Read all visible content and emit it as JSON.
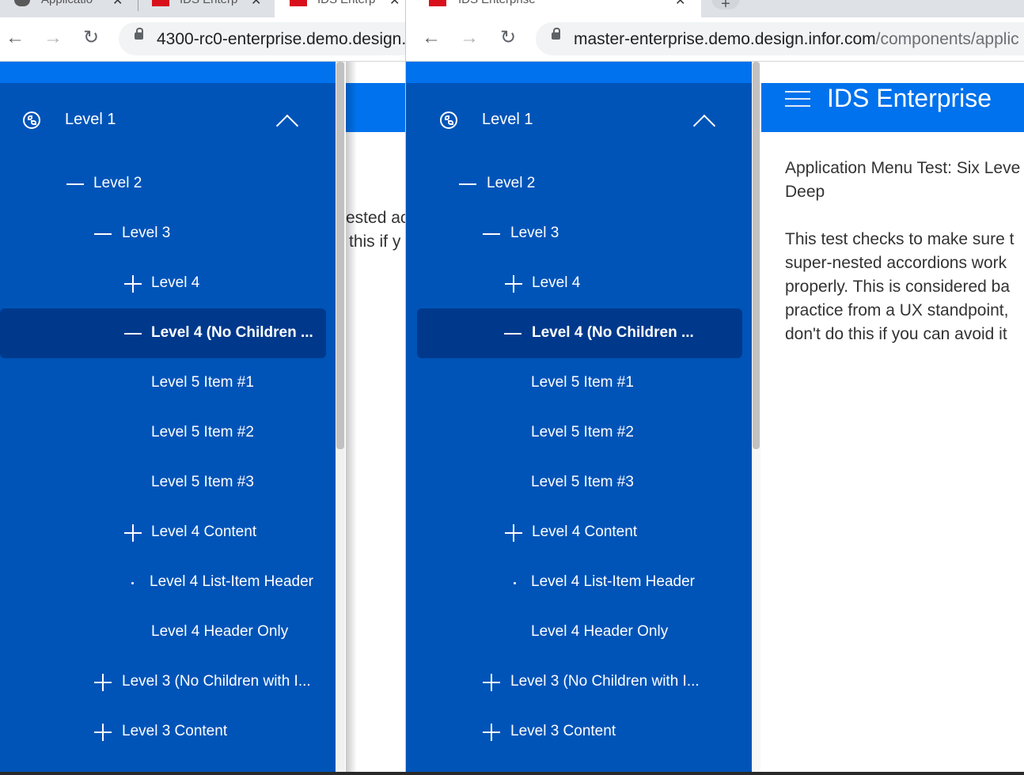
{
  "colors": {
    "menu_bg": "#0054b8",
    "menu_top": "#0072ed",
    "selected_bg": "#00398c",
    "header_bg": "#0072ed",
    "tabstrip": "#dee1e6"
  },
  "left_window": {
    "tabs": [
      {
        "title": "Applicatio",
        "favicon": "github-icon"
      },
      {
        "title": "IDS Enterp",
        "favicon": "ids-icon"
      },
      {
        "title": "IDS Enterp",
        "favicon": "ids-icon"
      }
    ],
    "url": "4300-rc0-enterprise.demo.design.",
    "content_fragment_1": "ested ac",
    "content_fragment_2": "this if y"
  },
  "right_window": {
    "tabs": [
      {
        "title": "IDS Enterprise",
        "favicon": "ids-icon"
      }
    ],
    "url_host": "master-enterprise.demo.design.infor.com",
    "url_path": "/components/applic",
    "header_title": "IDS Enterprise",
    "content_heading": "Application Menu Test: Six Leve\nDeep",
    "content_body": "This test checks to make sure t\nsuper-nested accordions work\nproperly. This is considered ba\npractice from a UX standpoint,\ndon't do this if you can avoid it"
  },
  "menu": {
    "level1": "Level 1",
    "items": [
      {
        "label": "Level 2",
        "icon": "collapse-dash-icon"
      },
      {
        "label": "Level 3",
        "icon": "collapse-dash-icon"
      },
      {
        "label": "Level 4",
        "icon": "expand-plus-icon"
      },
      {
        "label": "Level 4 (No Children ...",
        "icon": "collapse-dash-icon",
        "selected": true
      },
      {
        "label": "Level 5 Item #1"
      },
      {
        "label": "Level 5 Item #2"
      },
      {
        "label": "Level 5 Item #3"
      },
      {
        "label": "Level 4 Content",
        "icon": "expand-plus-icon"
      },
      {
        "label": "Level 4 List-Item Header",
        "icon": "bullet-dot-icon"
      },
      {
        "label": "Level 4 Header Only"
      },
      {
        "label": "Level 3 (No Children with I...",
        "icon": "expand-plus-icon"
      },
      {
        "label": "Level 3 Content",
        "icon": "expand-plus-icon"
      }
    ]
  }
}
